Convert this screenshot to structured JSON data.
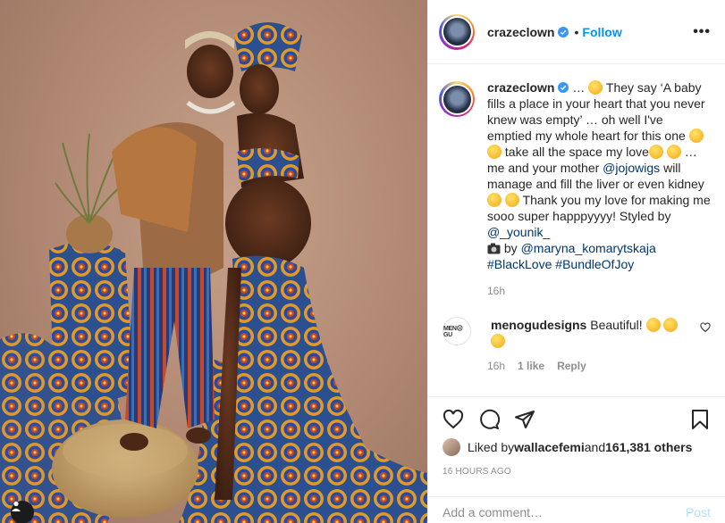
{
  "post": {
    "username": "crazeclown",
    "follow_label": "Follow",
    "more_label": "•••",
    "separator": "•"
  },
  "caption": {
    "username": "crazeclown",
    "parts": {
      "p1": " … ",
      "p2": " They say ‘A baby fills a place in your heart that you never knew was empty’ … oh well I've emptied my whole heart for this one ",
      "p3": " take all the space my love",
      "p4": " … me and your mother ",
      "mention1": "@jojowigs",
      "p5": " will manage and fill the liver or even kidney ",
      "p6": " Thank you my love for making me sooo super happpyyyy! Styled by ",
      "mention2": "@_younik_",
      "p7": " by ",
      "mention3": "@maryna_komarytskaja",
      "tag1": "#BlackLove",
      "tag2": "#BundleOfJoy"
    },
    "time": "16h"
  },
  "comment": {
    "username": "menogudesigns",
    "avatar_text": "MEN☹GU",
    "text": "Beautiful!",
    "time": "16h",
    "likes": "1 like",
    "reply": "Reply"
  },
  "likes": {
    "prefix": "Liked by ",
    "user": "wallacefemi",
    "and": " and ",
    "count": "161,381 others"
  },
  "timestamp": "16 HOURS AGO",
  "add_comment": {
    "placeholder": "Add a comment…",
    "post_label": "Post"
  },
  "icons": [
    "heart-icon",
    "comment-icon",
    "share-icon",
    "bookmark-icon",
    "verified-icon",
    "user-tag-icon",
    "camera-icon",
    "more-icon"
  ],
  "colors": {
    "accent": "#0095f6",
    "link": "#00376b",
    "muted": "#8e8e8e",
    "verified": "#3897f0",
    "post_disabled": "#b2dffc"
  }
}
